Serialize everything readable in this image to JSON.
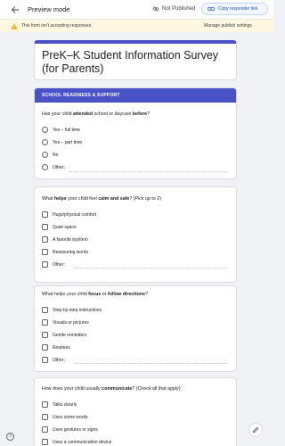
{
  "header": {
    "preview_label": "Preview mode",
    "status_label": "Not Published",
    "copy_label": "Copy responder link"
  },
  "notice": {
    "text": "This form isn't accepting responses.",
    "manage_label": "Manage publish settings"
  },
  "form": {
    "title": "PreK–K Student Information Survey (for Parents)",
    "section_title": "SCHOOL READINESS & SUPPORT"
  },
  "q1": {
    "pre": "Has your child ",
    "bold1": "attended",
    "mid": " school or daycare ",
    "bold2": "before",
    "post": "?",
    "options": [
      "Yes – full time",
      "Yes – part time",
      "No",
      "Other:"
    ]
  },
  "q2": {
    "pre": "What ",
    "bold1": "helps",
    "mid": " your child feel ",
    "bold2": "calm and safe",
    "post": "? (Pick up to 2)",
    "options": [
      "Hugs/physical comfort",
      "Quiet space",
      "A favorite toy/item",
      "Reassuring words",
      "Other:"
    ]
  },
  "q3": {
    "pre": "What helps your child ",
    "bold1": "focus",
    "mid": " or ",
    "bold2": "follow directions",
    "post": "?",
    "options": [
      "Step-by-step instructions",
      "Visuals or pictures",
      "Gentle reminders",
      "Routines",
      "Other:"
    ]
  },
  "q4": {
    "pre": "How does your child usually ",
    "bold1": "communicate",
    "post": "? (Check all that apply)",
    "options": [
      "Talks clearly",
      "Uses some words",
      "Uses gestures or signs",
      "Uses a communication device"
    ]
  },
  "icons": {
    "back": "arrow-left-icon",
    "not_published": "eye-off-icon",
    "copy_link": "link-icon",
    "warning": "warning-icon",
    "edit": "pencil-icon",
    "help": "help-icon"
  },
  "colors": {
    "accent": "#4a52c8",
    "link": "#1a56c8",
    "notice_bg": "#fff7e0"
  }
}
